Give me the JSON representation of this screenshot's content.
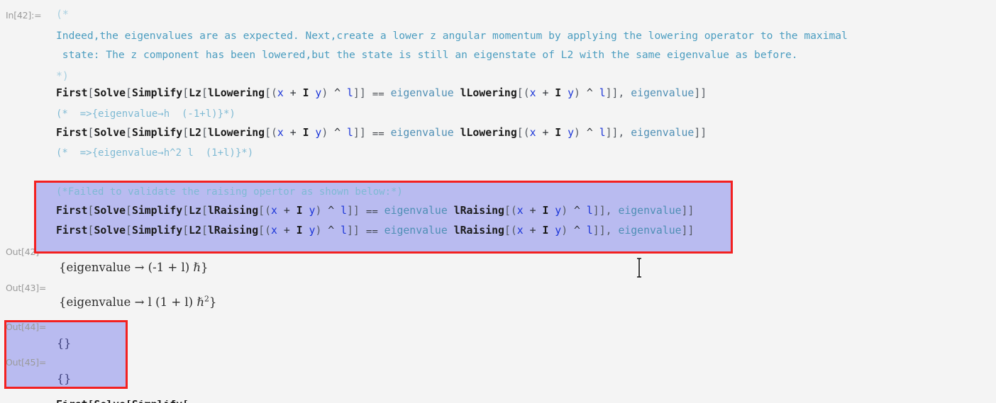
{
  "app": {
    "kind": "mathematica-notebook",
    "background": "#f4f4f4",
    "selection_fill": "#b9bbf0",
    "selection_border": "#f32020",
    "comment_color": "#5aa3c4",
    "symbol_color": "#4f8fb5",
    "variable_color": "#1c36d8",
    "label_color": "#9a9a9a"
  },
  "cells": {
    "in42_label": "In[42]:=",
    "out42_label": "Out[42]=",
    "out43_label": "Out[43]=",
    "out44_label": "Out[44]=",
    "out45_label": "Out[45]="
  },
  "input_cell": {
    "comment_open": "(*",
    "comment_close": "*)",
    "prose_line_1": "Indeed,the eigenvalues are as expected. Next,create a lower z angular momentum by applying the lowering operator to the maximal",
    "prose_line_2": " state: The z component has been lowered,but the state is still an eigenstate of L2 with the same eigenvalue as before.",
    "code_lines": [
      {
        "id": "lz-lowering",
        "tokens": [
          {
            "t": "First",
            "c": "fn"
          },
          {
            "t": "[",
            "c": "brk"
          },
          {
            "t": "Solve",
            "c": "fn"
          },
          {
            "t": "[",
            "c": "brk"
          },
          {
            "t": "Simplify",
            "c": "fn"
          },
          {
            "t": "[",
            "c": "brk"
          },
          {
            "t": "Lz",
            "c": "fn"
          },
          {
            "t": "[",
            "c": "brk"
          },
          {
            "t": "lLowering",
            "c": "fn"
          },
          {
            "t": "[",
            "c": "brk"
          },
          {
            "t": "(",
            "c": "brk"
          },
          {
            "t": "x",
            "c": "var"
          },
          {
            "t": " + ",
            "c": "op"
          },
          {
            "t": "I",
            "c": "fn"
          },
          {
            "t": " ",
            "c": "op"
          },
          {
            "t": "y",
            "c": "var"
          },
          {
            "t": ")",
            "c": "brk"
          },
          {
            "t": " ^ ",
            "c": "op"
          },
          {
            "t": "l",
            "c": "var"
          },
          {
            "t": "]]",
            "c": "brk"
          },
          {
            "t": " ⩵ ",
            "c": "op"
          },
          {
            "t": "eigenvalue",
            "c": "sym"
          },
          {
            "t": " ",
            "c": "op"
          },
          {
            "t": "lLowering",
            "c": "fn"
          },
          {
            "t": "[",
            "c": "brk"
          },
          {
            "t": "(",
            "c": "brk"
          },
          {
            "t": "x",
            "c": "var"
          },
          {
            "t": " + ",
            "c": "op"
          },
          {
            "t": "I",
            "c": "fn"
          },
          {
            "t": " ",
            "c": "op"
          },
          {
            "t": "y",
            "c": "var"
          },
          {
            "t": ")",
            "c": "brk"
          },
          {
            "t": " ^ ",
            "c": "op"
          },
          {
            "t": "l",
            "c": "var"
          },
          {
            "t": "]], ",
            "c": "brk"
          },
          {
            "t": "eigenvalue",
            "c": "sym"
          },
          {
            "t": "]]",
            "c": "brk"
          }
        ]
      },
      {
        "id": "l2-lowering",
        "tokens": [
          {
            "t": "First",
            "c": "fn"
          },
          {
            "t": "[",
            "c": "brk"
          },
          {
            "t": "Solve",
            "c": "fn"
          },
          {
            "t": "[",
            "c": "brk"
          },
          {
            "t": "Simplify",
            "c": "fn"
          },
          {
            "t": "[",
            "c": "brk"
          },
          {
            "t": "L2",
            "c": "fn"
          },
          {
            "t": "[",
            "c": "brk"
          },
          {
            "t": "lLowering",
            "c": "fn"
          },
          {
            "t": "[",
            "c": "brk"
          },
          {
            "t": "(",
            "c": "brk"
          },
          {
            "t": "x",
            "c": "var"
          },
          {
            "t": " + ",
            "c": "op"
          },
          {
            "t": "I",
            "c": "fn"
          },
          {
            "t": " ",
            "c": "op"
          },
          {
            "t": "y",
            "c": "var"
          },
          {
            "t": ")",
            "c": "brk"
          },
          {
            "t": " ^ ",
            "c": "op"
          },
          {
            "t": "l",
            "c": "var"
          },
          {
            "t": "]]",
            "c": "brk"
          },
          {
            "t": " ⩵ ",
            "c": "op"
          },
          {
            "t": "eigenvalue",
            "c": "sym"
          },
          {
            "t": " ",
            "c": "op"
          },
          {
            "t": "lLowering",
            "c": "fn"
          },
          {
            "t": "[",
            "c": "brk"
          },
          {
            "t": "(",
            "c": "brk"
          },
          {
            "t": "x",
            "c": "var"
          },
          {
            "t": " + ",
            "c": "op"
          },
          {
            "t": "I",
            "c": "fn"
          },
          {
            "t": " ",
            "c": "op"
          },
          {
            "t": "y",
            "c": "var"
          },
          {
            "t": ")",
            "c": "brk"
          },
          {
            "t": " ^ ",
            "c": "op"
          },
          {
            "t": "l",
            "c": "var"
          },
          {
            "t": "]], ",
            "c": "brk"
          },
          {
            "t": "eigenvalue",
            "c": "sym"
          },
          {
            "t": "]]",
            "c": "brk"
          }
        ]
      }
    ],
    "result_comment_1": "(*  =>{eigenvalue→h  (-1+l)}*)",
    "result_comment_2": "(*  =>{eigenvalue→h^2 l  (1+l)}*)"
  },
  "selected_cell": {
    "note_comment": "(*Failed to validate the raising opertor as shown below:*)",
    "code_lines": [
      {
        "id": "lz-raising",
        "tokens": [
          {
            "t": "First",
            "c": "fn"
          },
          {
            "t": "[",
            "c": "brk"
          },
          {
            "t": "Solve",
            "c": "fn"
          },
          {
            "t": "[",
            "c": "brk"
          },
          {
            "t": "Simplify",
            "c": "fn"
          },
          {
            "t": "[",
            "c": "brk"
          },
          {
            "t": "Lz",
            "c": "fn"
          },
          {
            "t": "[",
            "c": "brk"
          },
          {
            "t": "lRaising",
            "c": "fn"
          },
          {
            "t": "[",
            "c": "brk"
          },
          {
            "t": "(",
            "c": "brk"
          },
          {
            "t": "x",
            "c": "var"
          },
          {
            "t": " + ",
            "c": "op"
          },
          {
            "t": "I",
            "c": "fn"
          },
          {
            "t": " ",
            "c": "op"
          },
          {
            "t": "y",
            "c": "var"
          },
          {
            "t": ")",
            "c": "brk"
          },
          {
            "t": " ^ ",
            "c": "op"
          },
          {
            "t": "l",
            "c": "var"
          },
          {
            "t": "]]",
            "c": "brk"
          },
          {
            "t": " ⩵ ",
            "c": "op"
          },
          {
            "t": "eigenvalue",
            "c": "sym"
          },
          {
            "t": " ",
            "c": "op"
          },
          {
            "t": "lRaising",
            "c": "fn"
          },
          {
            "t": "[",
            "c": "brk"
          },
          {
            "t": "(",
            "c": "brk"
          },
          {
            "t": "x",
            "c": "var"
          },
          {
            "t": " + ",
            "c": "op"
          },
          {
            "t": "I",
            "c": "fn"
          },
          {
            "t": " ",
            "c": "op"
          },
          {
            "t": "y",
            "c": "var"
          },
          {
            "t": ")",
            "c": "brk"
          },
          {
            "t": " ^ ",
            "c": "op"
          },
          {
            "t": "l",
            "c": "var"
          },
          {
            "t": "]], ",
            "c": "brk"
          },
          {
            "t": "eigenvalue",
            "c": "sym"
          },
          {
            "t": "]]",
            "c": "brk"
          }
        ]
      },
      {
        "id": "l2-raising",
        "tokens": [
          {
            "t": "First",
            "c": "fn"
          },
          {
            "t": "[",
            "c": "brk"
          },
          {
            "t": "Solve",
            "c": "fn"
          },
          {
            "t": "[",
            "c": "brk"
          },
          {
            "t": "Simplify",
            "c": "fn"
          },
          {
            "t": "[",
            "c": "brk"
          },
          {
            "t": "L2",
            "c": "fn"
          },
          {
            "t": "[",
            "c": "brk"
          },
          {
            "t": "lRaising",
            "c": "fn"
          },
          {
            "t": "[",
            "c": "brk"
          },
          {
            "t": "(",
            "c": "brk"
          },
          {
            "t": "x",
            "c": "var"
          },
          {
            "t": " + ",
            "c": "op"
          },
          {
            "t": "I",
            "c": "fn"
          },
          {
            "t": " ",
            "c": "op"
          },
          {
            "t": "y",
            "c": "var"
          },
          {
            "t": ")",
            "c": "brk"
          },
          {
            "t": " ^ ",
            "c": "op"
          },
          {
            "t": "l",
            "c": "var"
          },
          {
            "t": "]]",
            "c": "brk"
          },
          {
            "t": " ⩵ ",
            "c": "op"
          },
          {
            "t": "eigenvalue",
            "c": "sym"
          },
          {
            "t": " ",
            "c": "op"
          },
          {
            "t": "lRaising",
            "c": "fn"
          },
          {
            "t": "[",
            "c": "brk"
          },
          {
            "t": "(",
            "c": "brk"
          },
          {
            "t": "x",
            "c": "var"
          },
          {
            "t": " + ",
            "c": "op"
          },
          {
            "t": "I",
            "c": "fn"
          },
          {
            "t": " ",
            "c": "op"
          },
          {
            "t": "y",
            "c": "var"
          },
          {
            "t": ")",
            "c": "brk"
          },
          {
            "t": " ^ ",
            "c": "op"
          },
          {
            "t": "l",
            "c": "var"
          },
          {
            "t": "]], ",
            "c": "brk"
          },
          {
            "t": "eigenvalue",
            "c": "sym"
          },
          {
            "t": "]]",
            "c": "brk"
          }
        ]
      }
    ]
  },
  "outputs": {
    "out42_expr_prefix": "{eigenvalue → (-1 + l) ℏ}",
    "out43_expr_prefix": "{eigenvalue → l (1 + l) ℏ",
    "out43_exponent": "2",
    "out43_expr_suffix": "}",
    "out44_value": "{}",
    "out45_value": "{}"
  }
}
